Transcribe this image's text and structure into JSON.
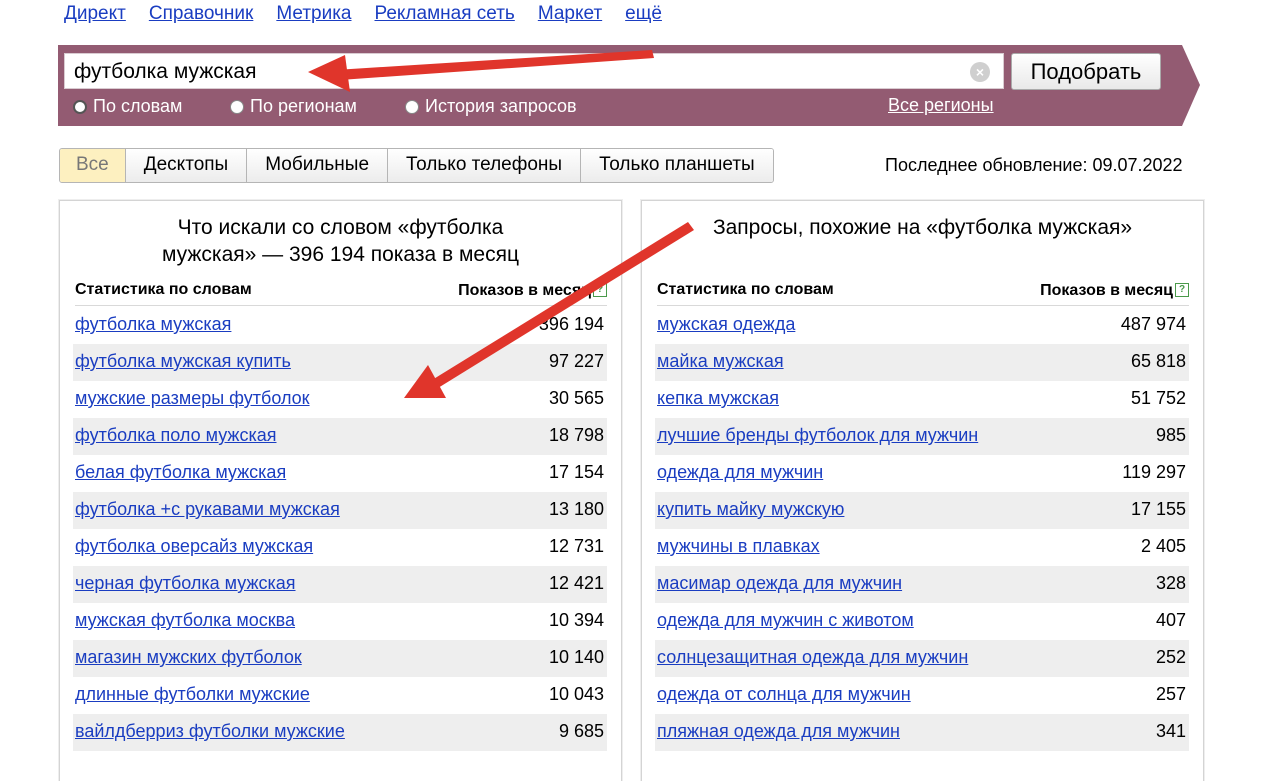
{
  "topnav": [
    "Директ",
    "Справочник",
    "Метрика",
    "Рекламная сеть",
    "Маркет",
    "ещё"
  ],
  "search": {
    "value": "футболка мужская",
    "button": "Подобрать",
    "clear_icon": "×"
  },
  "modes": {
    "by_words": "По словам",
    "by_regions": "По регионам",
    "history": "История запросов",
    "regions_link": "Все регионы"
  },
  "tabs": [
    "Все",
    "Десктопы",
    "Мобильные",
    "Только телефоны",
    "Только планшеты"
  ],
  "updated": "Последнее обновление: 09.07.2022",
  "left": {
    "title_line1": "Что искали со словом «футболка",
    "title_line2": "мужская» — 396 194 показа в месяц",
    "col1": "Статистика по словам",
    "col2": "Показов в месяц",
    "rows": [
      {
        "phrase": "футболка мужская",
        "count": "396 194"
      },
      {
        "phrase": "футболка мужская купить",
        "count": "97 227"
      },
      {
        "phrase": "мужские размеры футболок",
        "count": "30 565"
      },
      {
        "phrase": "футболка поло мужская",
        "count": "18 798"
      },
      {
        "phrase": "белая футболка мужская",
        "count": "17 154"
      },
      {
        "phrase": "футболка +с рукавами мужская",
        "count": "13 180"
      },
      {
        "phrase": "футболка оверсайз мужская",
        "count": "12 731"
      },
      {
        "phrase": "черная футболка мужская",
        "count": "12 421"
      },
      {
        "phrase": "мужская футболка москва",
        "count": "10 394"
      },
      {
        "phrase": "магазин мужских футболок",
        "count": "10 140"
      },
      {
        "phrase": "длинные футболки мужские",
        "count": "10 043"
      },
      {
        "phrase": "вайлдберриз футболки мужские",
        "count": "9 685"
      }
    ]
  },
  "right": {
    "title": "Запросы, похожие на «футболка мужская»",
    "col1": "Статистика по словам",
    "col2": "Показов в месяц",
    "rows": [
      {
        "phrase": "мужская одежда",
        "count": "487 974"
      },
      {
        "phrase": "майка мужская",
        "count": "65 818"
      },
      {
        "phrase": "кепка мужская",
        "count": "51 752"
      },
      {
        "phrase": "лучшие бренды футболок для мужчин",
        "count": "985"
      },
      {
        "phrase": "одежда для мужчин",
        "count": "119 297"
      },
      {
        "phrase": "купить майку мужскую",
        "count": "17 155"
      },
      {
        "phrase": "мужчины в плавках",
        "count": "2 405"
      },
      {
        "phrase": "масимар одежда для мужчин",
        "count": "328"
      },
      {
        "phrase": "одежда для мужчин с животом",
        "count": "407"
      },
      {
        "phrase": "солнцезащитная одежда для мужчин",
        "count": "252"
      },
      {
        "phrase": "одежда от солнца для мужчин",
        "count": "257"
      },
      {
        "phrase": "пляжная одежда для мужчин",
        "count": "341"
      }
    ]
  },
  "colors": {
    "band": "#935b72",
    "link": "#1a3dc1",
    "arrow": "#e0352b",
    "active_tab": "#fdf0c0"
  },
  "icons": {
    "clear": "clear-icon",
    "help": "help-icon"
  }
}
